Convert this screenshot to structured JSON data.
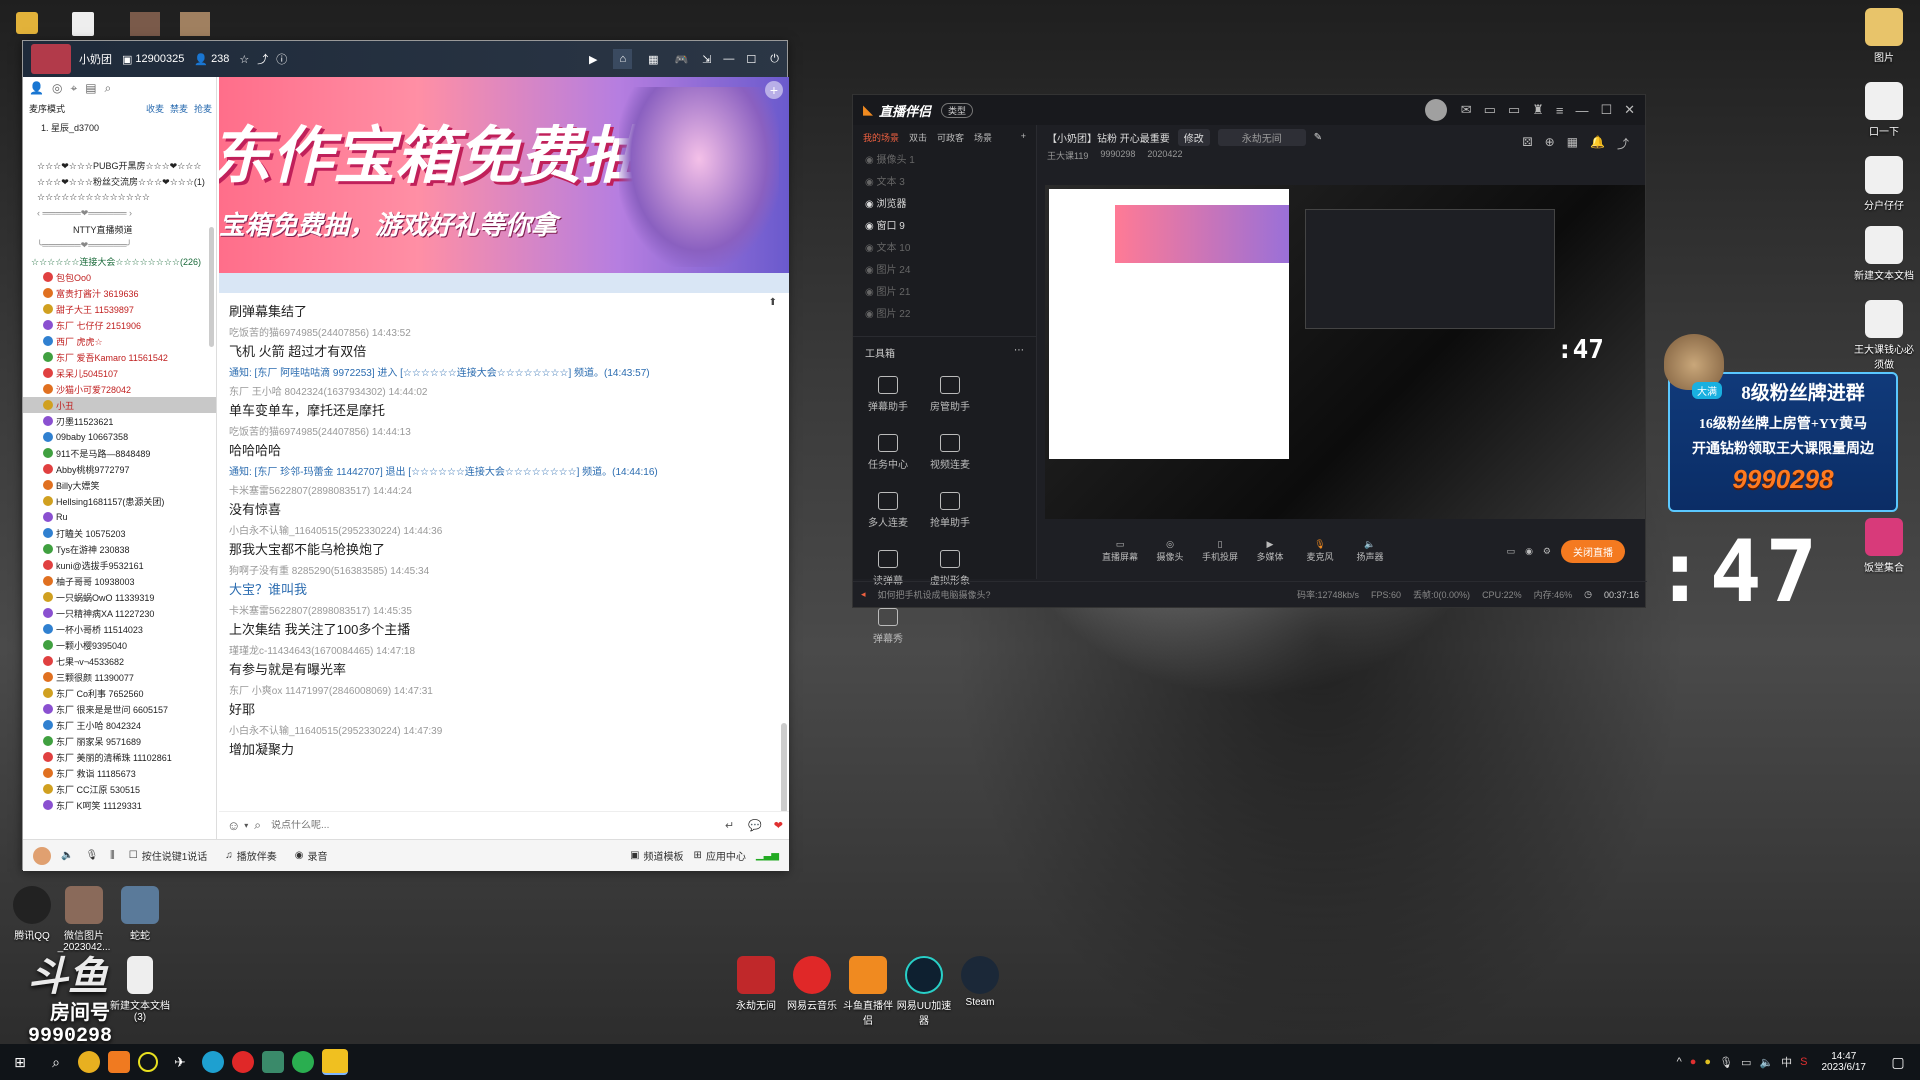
{
  "desktop_icons_right": [
    {
      "label": "图片"
    },
    {
      "label": "口一下"
    },
    {
      "label": "分户仔仔"
    },
    {
      "label": "新建文本文档"
    },
    {
      "label": "王大课钱心必须做"
    },
    {
      "label": "饭堂集合"
    }
  ],
  "desktop_icons_left": [
    {
      "label": "腾讯QQ"
    },
    {
      "label": "微信图片_2023042..."
    },
    {
      "label": "蛇蛇"
    },
    {
      "label": "新建文本文档 (3)"
    }
  ],
  "desktop_icons_bottom": [
    {
      "label": "永劫无间"
    },
    {
      "label": "网易云音乐"
    },
    {
      "label": "斗鱼直播伴侣"
    },
    {
      "label": "网易UU加速器"
    },
    {
      "label": "Steam"
    }
  ],
  "watermark": {
    "brand": "斗鱼",
    "room_label": "房间号",
    "room_number": "9990298"
  },
  "yy": {
    "channel_name": "小奶团",
    "channel_id": "12900325",
    "viewers": "238",
    "mode_label": "麦序模式",
    "left_tabs": [
      "收麦",
      "禁麦",
      "抢麦"
    ],
    "first_user": "1. 星辰_d3700",
    "groups": [
      "☆☆☆❤☆☆☆PUBG开黑房☆☆☆❤☆☆☆",
      "☆☆☆❤☆☆☆粉丝交流房☆☆☆❤☆☆☆(1)",
      "☆☆☆☆☆☆☆☆☆☆☆☆☆☆",
      "NTTY直播频道",
      "☆☆☆☆☆☆连接大会☆☆☆☆☆☆☆☆(226)"
    ],
    "users": [
      "包包Oo0",
      "富贵打酱汁 3619636",
      "甜子大王 11539897",
      "东厂 七仔仔 2151906",
      "西厂 虎虎☆",
      "东厂 爱吾Kamaro 11561542",
      "呆呆儿5045107",
      "沙猫小可爱728042",
      "小丑",
      "刃墨11523621",
      "09baby 10667358",
      "911不是马路—8848489",
      "Abby桃桃9772797",
      "Billy大嫖笑",
      "Hellsing1681157(患源关团)",
      "Ru",
      "打瞌关 10575203",
      "Tys在游神 230838",
      "kuni@选拔手9532161",
      "柚子哥哥 10938003",
      "一只蜗蜗OwO 11339319",
      "一只精神病XA 11227230",
      "一杯小哥桥 11514023",
      "一颗小樱9395040",
      "七果¬v¬4533682",
      "三颗很颜 11390077",
      "东厂 Co利事 7652560",
      "东厂 很来是是世问 6605157",
      "东厂 王小哈 8042324",
      "东厂 丽家呆 9571689",
      "东厂 美丽的清稀珠 11102861",
      "东厂 救诣 11185673",
      "东厂 CC江原 530515",
      "东厂 K呵笑 11129331"
    ],
    "banner": {
      "line1": "东作宝箱免费抽",
      "line2": "宝箱免费抽，游戏好礼等你拿"
    },
    "chat": [
      {
        "meta": "",
        "msg": "刷弹幕集结了"
      },
      {
        "meta": "吃饭苦的猫6974985(24407856) 14:43:52",
        "msg": "飞机 火箭 超过才有双倍"
      },
      {
        "notice": "通知: [东厂 阿哇咕咕滴 9972253] 进入 [☆☆☆☆☆☆连接大会☆☆☆☆☆☆☆☆] 频道。(14:43:57)"
      },
      {
        "meta": "东厂 王小哈 8042324(1637934302) 14:44:02",
        "msg": "单车变单车，摩托还是摩托"
      },
      {
        "meta": "吃饭苦的猫6974985(24407856) 14:44:13",
        "msg": "哈哈哈哈"
      },
      {
        "notice": "通知: [东厂 珍邻-玛蕾金 11442707] 退出 [☆☆☆☆☆☆连接大会☆☆☆☆☆☆☆☆] 频道。(14:44:16)"
      },
      {
        "meta": "卡米塞雷5622807(2898083517) 14:44:24",
        "msg": "没有惊喜"
      },
      {
        "meta": "小白永不认输_11640515(2952330224) 14:44:36",
        "msg": "那我大宝都不能乌枪换炮了"
      },
      {
        "meta": "狗啊子没有重 8285290(516383585) 14:45:34",
        "msg": "大宝？谁叫我"
      },
      {
        "meta": "卡米塞雷5622807(2898083517) 14:45:35",
        "msg": "上次集结 我关注了100多个主播"
      },
      {
        "meta": "瑾瑾龙c-11434643(1670084465) 14:47:18",
        "msg": "有参与就是有曝光率"
      },
      {
        "meta": "东厂 小爽ox 11471997(2846008069) 14:47:31",
        "msg": "好耶"
      },
      {
        "meta": "小白永不认输_11640515(2952330224) 14:47:39",
        "msg": "增加凝聚力"
      }
    ],
    "input_placeholder": "说点什么呢...",
    "bottom_bar": [
      "按住说键1说话",
      "播放伴奏",
      "录音"
    ],
    "bottom_right": [
      "频道模板",
      "应用中心"
    ]
  },
  "zb": {
    "title": "直播伴侣",
    "title_badge": "类型",
    "scene_tabs": [
      "我的场景",
      "双击",
      "可政客",
      "场景"
    ],
    "scenes": [
      "摄像头 1",
      "文本 3",
      "浏览器",
      "窗口 9",
      "文本 10",
      "图片 24",
      "图片 21",
      "图片 22"
    ],
    "room_title": "【小奶团】钻粉 开心最重要",
    "edit_label": "修改",
    "category": "永劫无间",
    "room_info": [
      "王大课119",
      "9990298",
      "2020422"
    ],
    "tools_label": "工具箱",
    "tools": [
      "弹幕助手",
      "房管助手",
      "任务中心",
      "视频连麦",
      "多人连麦",
      "抢单助手",
      "读弹幕",
      "虚拟形象",
      "弹幕秀"
    ],
    "controls": [
      "直播屏幕",
      "摄像头",
      "手机投屏",
      "多媒体",
      "麦克风",
      "扬声器"
    ],
    "stop_button": "关闭直播",
    "status": {
      "hint": "如何把手机设成电脑摄像头?",
      "bitrate": "码率:12748kb/s",
      "fps": "FPS:60",
      "drop": "丢帧:0(0.00%)",
      "cpu": "CPU:22%",
      "mem": "内存:46%",
      "time": "00:37:16"
    }
  },
  "fan": {
    "badge": "大满",
    "line1": "8级粉丝牌进群",
    "line2": "16级粉丝牌上房管+YY黄马",
    "line3": "开通钻粉领取王大课限量周边",
    "number": "9990298"
  },
  "big_clock": ":47",
  "small_clock": ":47",
  "tray": {
    "time": "14:47",
    "date": "2023/6/17",
    "ime": "中"
  }
}
